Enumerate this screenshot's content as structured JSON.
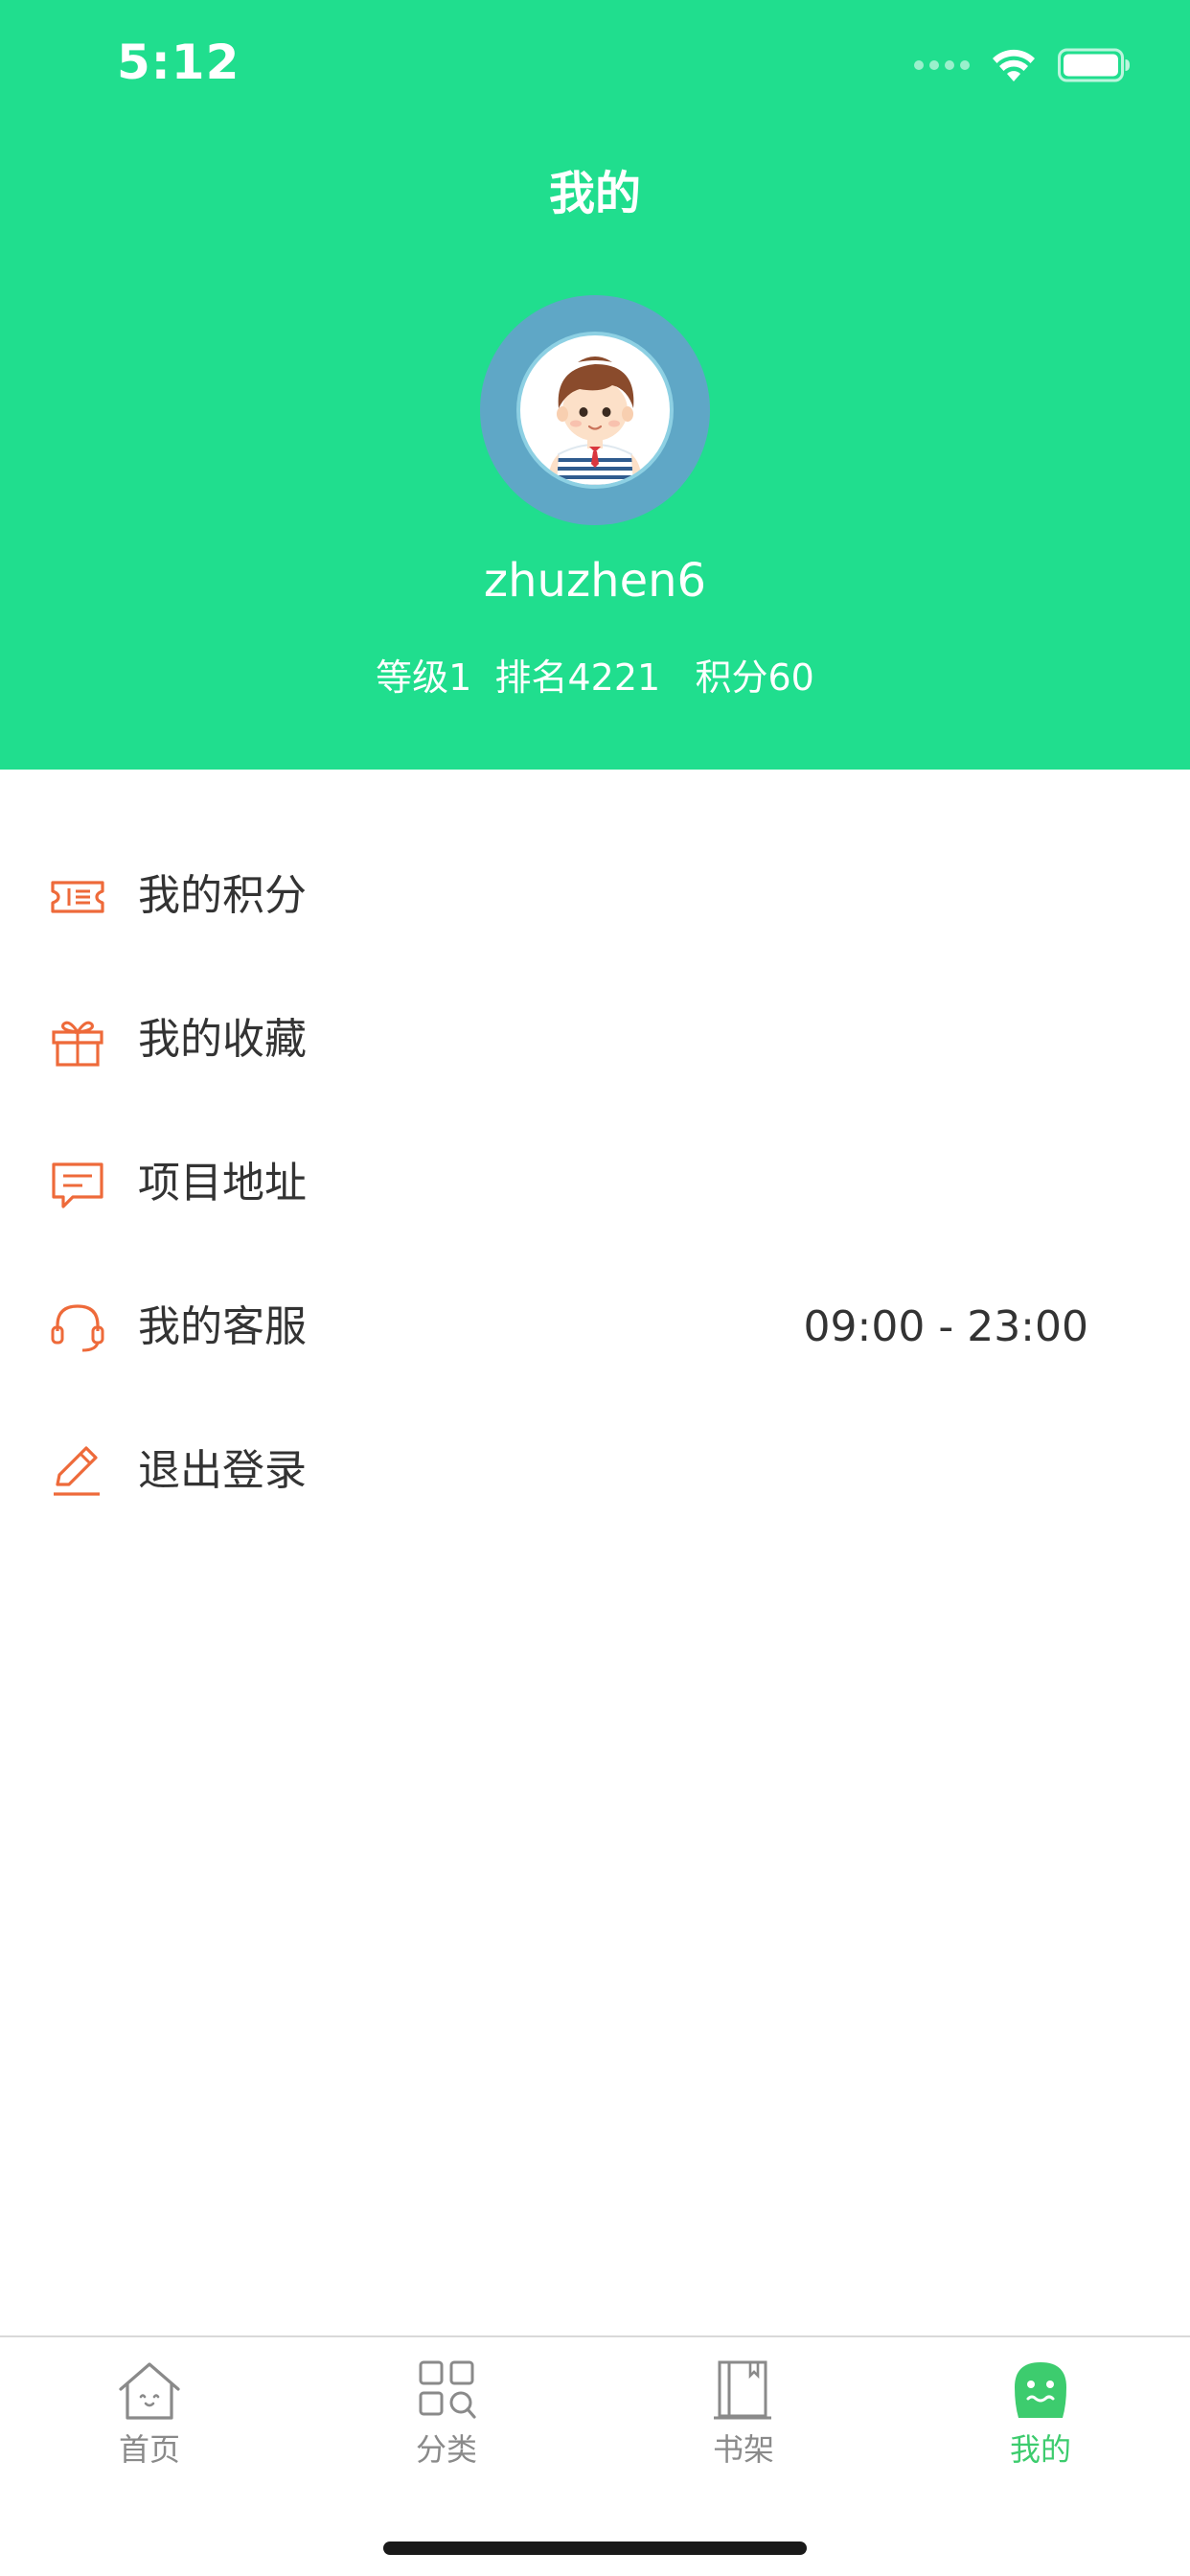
{
  "status_bar": {
    "time": "5:12"
  },
  "header": {
    "title": "我的",
    "username": "zhuzhen6",
    "stats": "等级1  排名4221   积分60",
    "background_color": "#20DE8E"
  },
  "menu": {
    "items": [
      {
        "label": "我的积分",
        "icon": "ticket-icon"
      },
      {
        "label": "我的收藏",
        "icon": "gift-icon"
      },
      {
        "label": "项目地址",
        "icon": "message-icon"
      },
      {
        "label": "我的客服",
        "icon": "headset-icon",
        "value": "09:00 - 23:00"
      },
      {
        "label": "退出登录",
        "icon": "edit-icon"
      }
    ],
    "icon_color": "#EE6A3A"
  },
  "tab_bar": {
    "tabs": [
      {
        "label": "首页",
        "icon": "home-icon"
      },
      {
        "label": "分类",
        "icon": "category-icon"
      },
      {
        "label": "书架",
        "icon": "bookshelf-icon"
      },
      {
        "label": "我的",
        "icon": "profile-face-icon",
        "active": true
      }
    ],
    "active_color": "#3DCC6E",
    "inactive_color": "#8A8A8A"
  }
}
